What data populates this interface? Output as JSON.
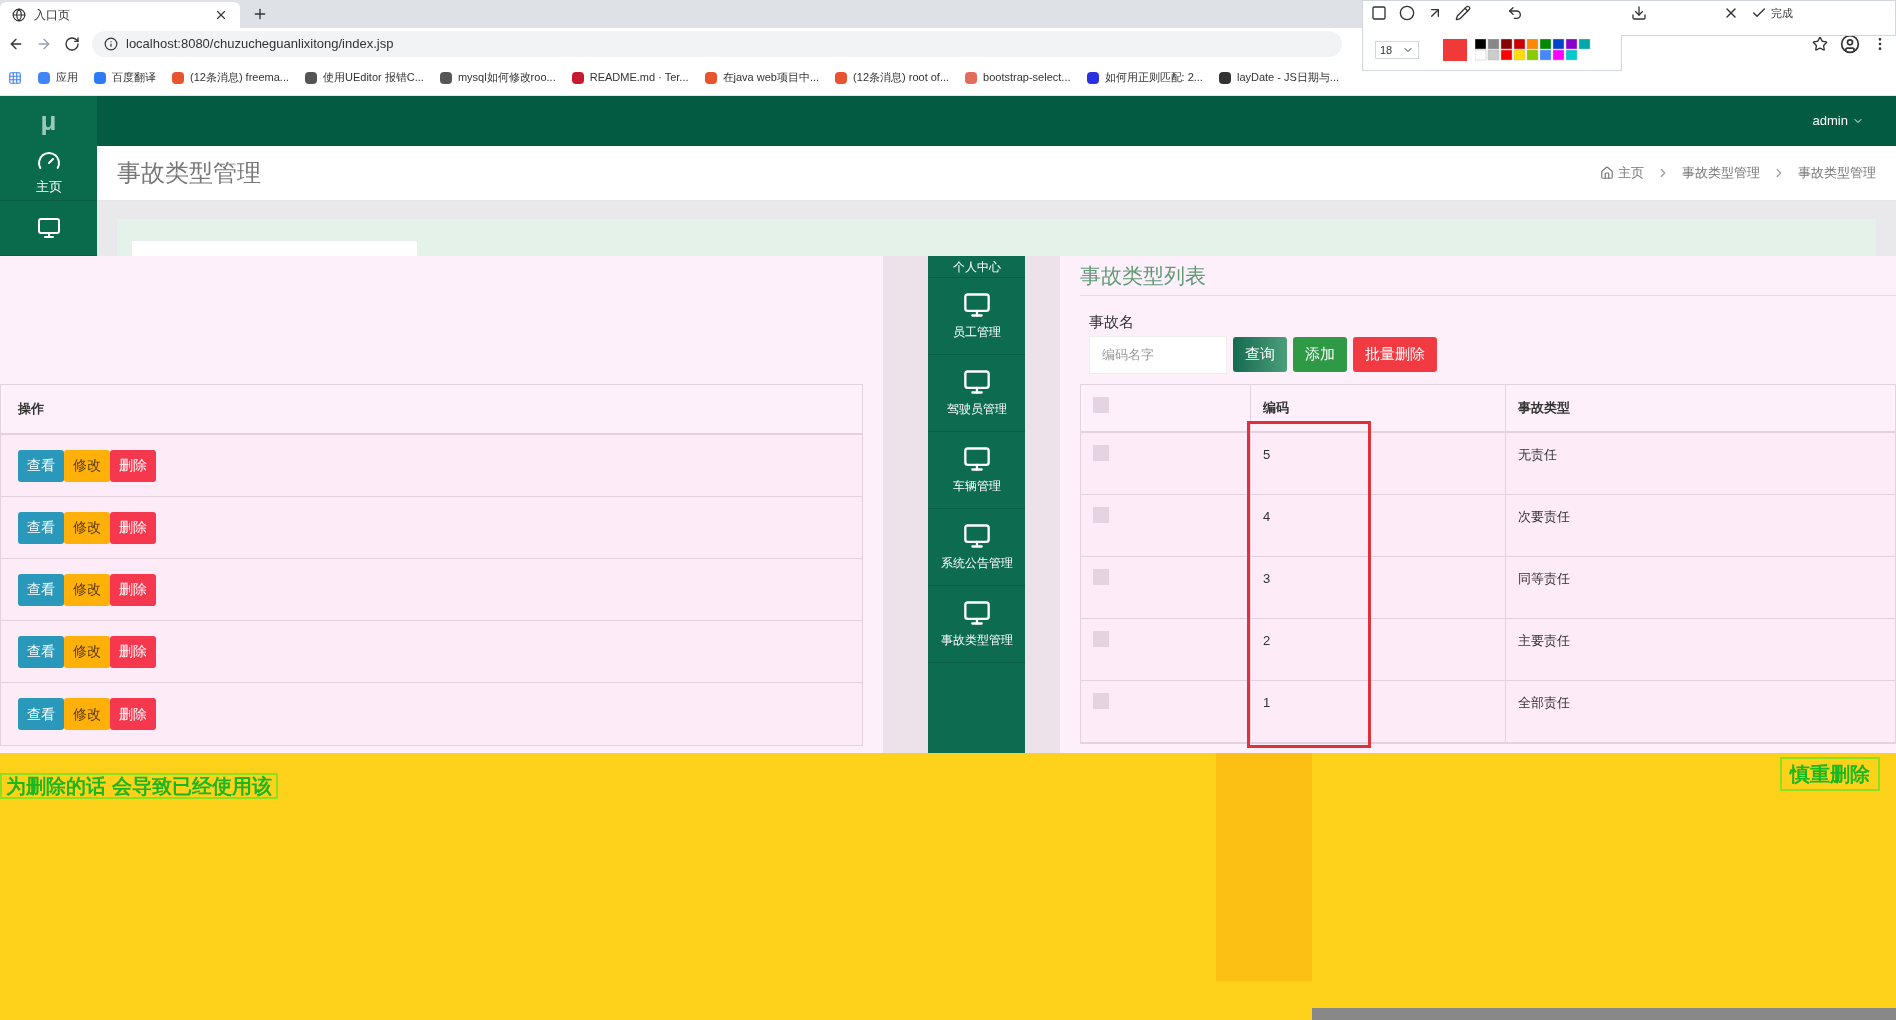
{
  "browser": {
    "tab_title": "入口页",
    "address": "localhost:8080/chuzucheguanlixitong/index.jsp",
    "bookmarks": [
      {
        "label": "应用",
        "color": "#4285f4"
      },
      {
        "label": "百度翻译",
        "color": "#2d7cf5"
      },
      {
        "label": "(12条消息) freema...",
        "color": "#e8542d"
      },
      {
        "label": "使用UEditor 报错C...",
        "color": "#555555"
      },
      {
        "label": "mysql如何修改roo...",
        "color": "#555555"
      },
      {
        "label": "README.md · Ter...",
        "color": "#c7192f"
      },
      {
        "label": "在java web项目中...",
        "color": "#e8542d"
      },
      {
        "label": "(12条消息) root of...",
        "color": "#e8542d"
      },
      {
        "label": "bootstrap-select...",
        "color": "#e26d5a"
      },
      {
        "label": "如何用正则匹配: 2...",
        "color": "#2932e1"
      },
      {
        "label": "layDate - JS日期与...",
        "color": "#333333"
      }
    ],
    "annotation_toolbar": {
      "font_size": "18",
      "done": "完成"
    }
  },
  "header": {
    "brand": "μ",
    "user": "admin"
  },
  "sidebar": {
    "items": [
      {
        "label": "主页",
        "kind": "dashboard"
      },
      {
        "kind": "monitor"
      }
    ]
  },
  "page": {
    "title": "事故类型管理",
    "breadcrumbs": [
      "主页",
      "事故类型管理",
      "事故类型管理"
    ]
  },
  "left_table": {
    "column": "操作",
    "rows": [
      [
        "查看",
        "修改",
        "删除"
      ],
      [
        "查看",
        "修改",
        "删除"
      ],
      [
        "查看",
        "修改",
        "删除"
      ],
      [
        "查看",
        "修改",
        "删除"
      ],
      [
        "查看",
        "修改",
        "删除"
      ]
    ]
  },
  "nav_menu": {
    "items": [
      "个人中心",
      "员工管理",
      "驾驶员管理",
      "车辆管理",
      "系统公告管理",
      "事故类型管理"
    ]
  },
  "list_panel": {
    "title": "事故类型列表",
    "filter_label": "事故名",
    "placeholder": "编码名字",
    "buttons": [
      {
        "label": "查询",
        "kind": "query"
      },
      {
        "label": "添加",
        "kind": "add"
      },
      {
        "label": "批量删除",
        "kind": "delete"
      }
    ],
    "all_checked": false,
    "columns": [
      "编码",
      "事故类型"
    ],
    "rows": [
      {
        "code": "5",
        "type": "无责任",
        "checked": false
      },
      {
        "code": "4",
        "type": "次要责任",
        "checked": false
      },
      {
        "code": "3",
        "type": "同等责任",
        "checked": false
      },
      {
        "code": "2",
        "type": "主要责任",
        "checked": false
      },
      {
        "code": "1",
        "type": "全部责任",
        "checked": false
      }
    ]
  },
  "annotations": [
    "为删除的话 会导致已经使用该",
    "慎重删除"
  ]
}
